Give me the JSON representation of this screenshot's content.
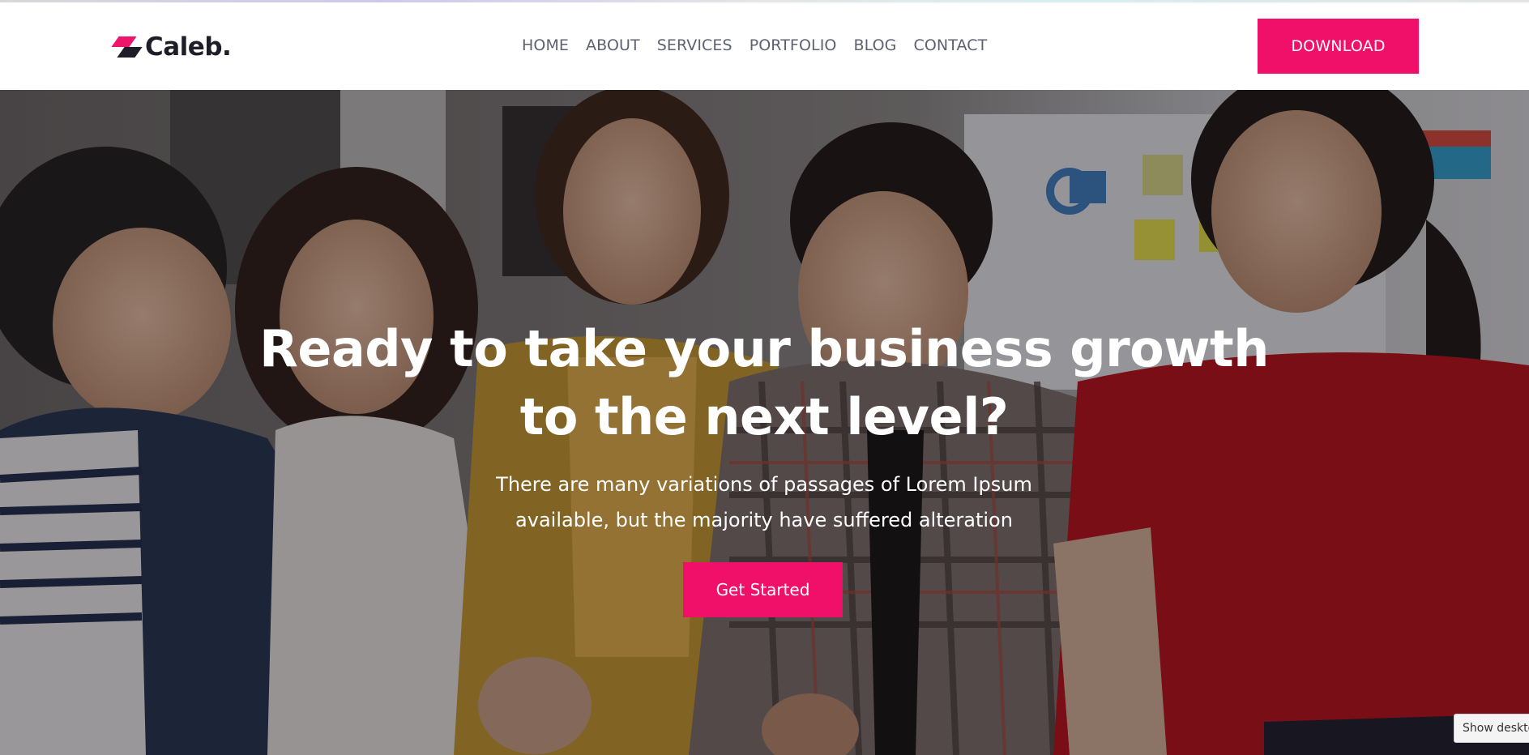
{
  "brand": {
    "name": "Caleb.",
    "accent_color": "#f0106a",
    "dark_color": "#1e1e28"
  },
  "nav": {
    "items": [
      "HOME",
      "ABOUT",
      "SERVICES",
      "PORTFOLIO",
      "BLOG",
      "CONTACT"
    ]
  },
  "header": {
    "download_label": "DOWNLOAD"
  },
  "hero": {
    "title_line1": "Ready to take your business growth",
    "title_line2": "to the next level?",
    "subtitle_line1": "There are many variations of passages of Lorem Ipsum",
    "subtitle_line2": "available, but the majority have suffered alteration",
    "cta_label": "Get Started",
    "background_icon": "team-photo"
  },
  "tooltip": {
    "text": "Show desktop"
  }
}
